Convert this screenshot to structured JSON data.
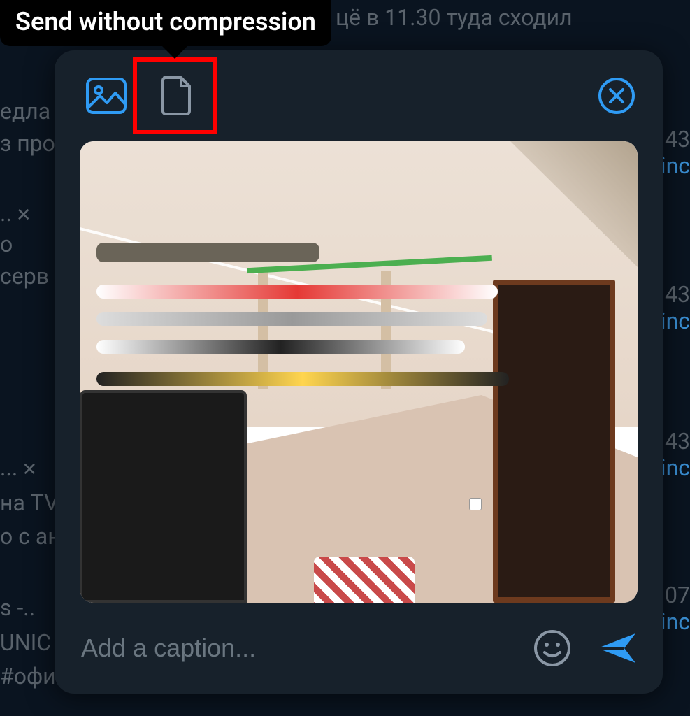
{
  "tooltip": {
    "label": "Send without compression"
  },
  "caption": {
    "placeholder": "Add a caption..."
  },
  "background": {
    "top_line": "цё в 11.30 туда сходил",
    "left_frag_1": "едла",
    "left_frag_2": "з про",
    "left_dots_1": "..",
    "left_frag_3": "о",
    "left_frag_4": "серв",
    "left_dots_2": "...",
    "left_frag_5": "на TV",
    "left_frag_6": "о с ан",
    "left_frag_7": "s -..",
    "left_frag_8": "UNIC",
    "left_frag_9": "#офи",
    "ts_43": "43",
    "ts_07": "07",
    "inc": "inc"
  },
  "icons": {
    "photo": "photo-icon",
    "file": "file-icon",
    "close": "close-icon",
    "emoji": "emoji-icon",
    "send": "send-icon"
  },
  "colors": {
    "accent": "#2f9bf4",
    "highlight": "#ff0000"
  }
}
